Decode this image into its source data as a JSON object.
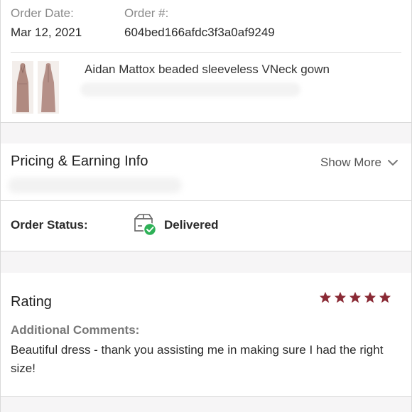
{
  "order": {
    "date_label": "Order Date:",
    "date_value": "Mar 12, 2021",
    "number_label": "Order #:",
    "number_value": "604bed166afdc3f3a0af9249"
  },
  "product": {
    "name": "Aidan Mattox beaded sleeveless VNeck gown",
    "thumbnail_color": "#b08a80"
  },
  "pricing": {
    "title": "Pricing & Earning Info",
    "show_more_label": "Show More",
    "chevron_icon": "chevron-down-icon"
  },
  "status": {
    "label": "Order Status:",
    "value": "Delivered",
    "icon": "delivered-box-check-icon",
    "check_color": "#2eb157"
  },
  "rating": {
    "title": "Rating",
    "stars": 5,
    "max_stars": 5,
    "star_color": "#8a2a35",
    "comments_label": "Additional Comments:",
    "comments_text": "Beautiful dress - thank you assisting me in making sure I had the right size!"
  },
  "colors": {
    "section_gap": "#f6f5f6",
    "divider": "#d9d9d9",
    "muted_text": "#8a8a8a"
  }
}
